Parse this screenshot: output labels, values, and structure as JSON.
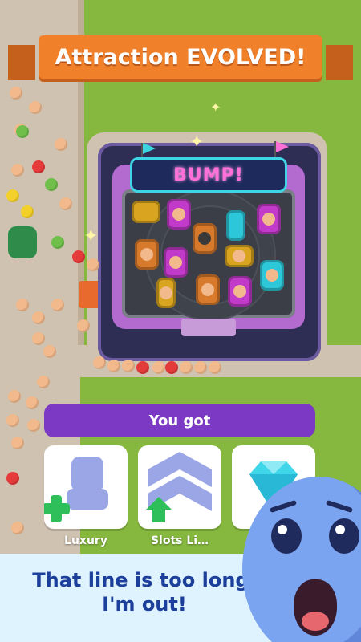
{
  "banner": {
    "title": "Attraction EVOLVED!"
  },
  "attraction": {
    "sign": "BUMP!"
  },
  "reward_panel": {
    "header": "You got"
  },
  "rewards": [
    {
      "label": "Luxury",
      "icon": "luxury-seat-icon",
      "accent": "#2fbf5a"
    },
    {
      "label": "Slots Li…",
      "icon": "chevron-upgrade-icon",
      "accent": "#2fbf5a"
    },
    {
      "label": "",
      "icon": "diamond-icon",
      "accent": "#3fd6ea"
    }
  ],
  "caption": {
    "line1": "That line is too long,",
    "line2": "I'm out!"
  },
  "colors": {
    "banner": "#f0812a",
    "panel": "#7b39c4",
    "caption": "#1b3f9a",
    "grass": "#86b83f"
  }
}
